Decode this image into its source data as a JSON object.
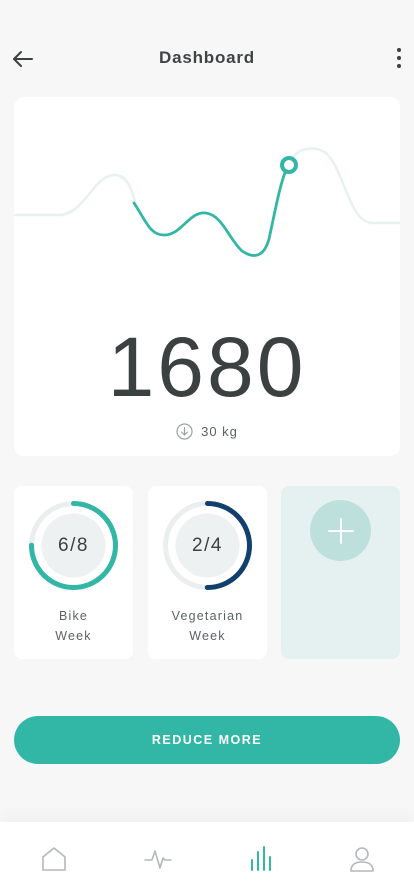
{
  "header": {
    "title": "Dashboard",
    "back_icon": "arrow-left-icon",
    "more_icon": "more-vertical-icon"
  },
  "summary": {
    "value": "1680",
    "reduction": "30 kg",
    "reduction_icon": "arrow-down-circle-icon"
  },
  "goals": [
    {
      "progress": "6/8",
      "label_line1": "Bike",
      "label_line2": "Week",
      "done": 6,
      "total": 8,
      "color": "#32b6a6"
    },
    {
      "progress": "2/4",
      "label_line1": "Vegetarian",
      "label_line2": "Week",
      "done": 2,
      "total": 4,
      "color": "#12406e"
    }
  ],
  "add_goal": {
    "icon": "plus-icon"
  },
  "action": {
    "label": "REDUCE MORE"
  },
  "nav": [
    {
      "icon": "home-icon",
      "active": false
    },
    {
      "icon": "activity-icon",
      "active": false
    },
    {
      "icon": "bar-chart-icon",
      "active": true
    },
    {
      "icon": "user-icon",
      "active": false
    }
  ],
  "colors": {
    "accent": "#32b6a6",
    "accent_light": "#bde0dc",
    "navy": "#12406e",
    "text": "#3b4141"
  }
}
